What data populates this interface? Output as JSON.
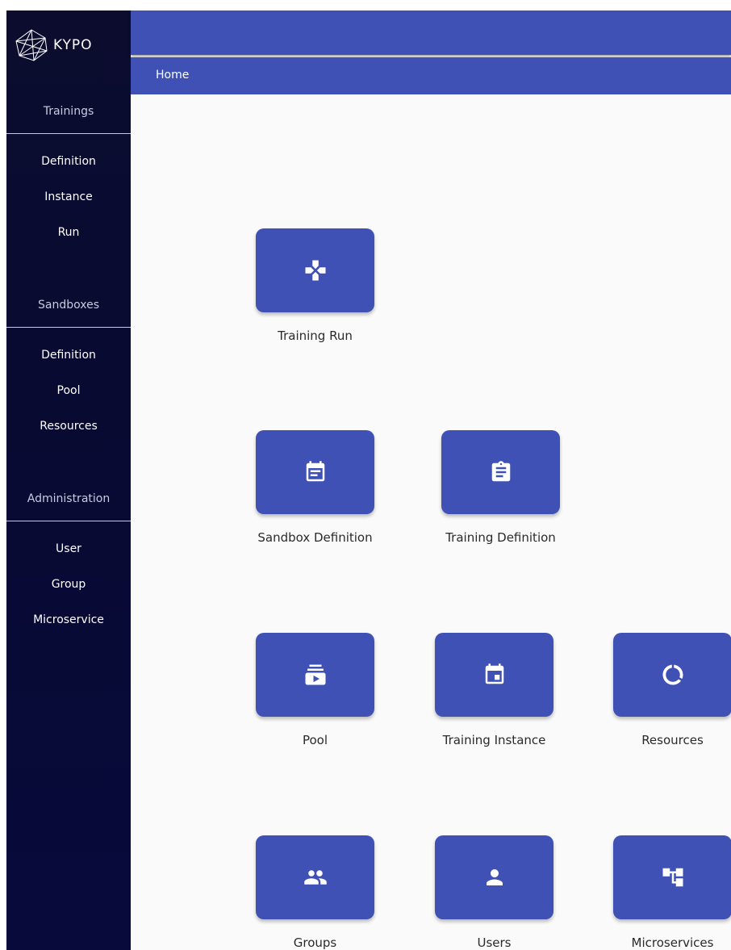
{
  "app": {
    "brand": "KYPO"
  },
  "sidebar": {
    "sections": [
      {
        "heading": "Trainings",
        "items": [
          "Definition",
          "Instance",
          "Run"
        ]
      },
      {
        "heading": "Sandboxes",
        "items": [
          "Definition",
          "Pool",
          "Resources"
        ]
      },
      {
        "heading": "Administration",
        "items": [
          "User",
          "Group",
          "Microservice"
        ]
      }
    ]
  },
  "breadcrumb": {
    "label": "Home"
  },
  "tiles": [
    {
      "label": "Training Run",
      "icon": "gamepad-icon"
    },
    {
      "label": "Sandbox Definition",
      "icon": "event-note-icon"
    },
    {
      "label": "Training Definition",
      "icon": "assignment-icon"
    },
    {
      "label": "Pool",
      "icon": "subscriptions-icon"
    },
    {
      "label": "Training Instance",
      "icon": "event-icon"
    },
    {
      "label": "Resources",
      "icon": "data-usage-icon"
    },
    {
      "label": "Groups",
      "icon": "people-icon"
    },
    {
      "label": "Users",
      "icon": "person-icon"
    },
    {
      "label": "Microservices",
      "icon": "account-tree-icon"
    }
  ],
  "colors": {
    "primary": "#3f51b5",
    "sidebar": "#0b0c2e"
  }
}
